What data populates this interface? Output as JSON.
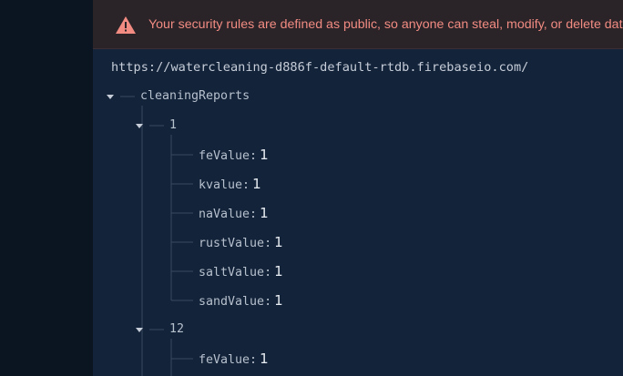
{
  "warning": {
    "icon": "warning-triangle-icon",
    "text": "Your security rules are defined as public, so anyone can steal, modify, or delete data in your database",
    "color": "#f28b82"
  },
  "database": {
    "url": "https://watercleaning-d886f-default-rtdb.firebaseio.com/"
  },
  "tree": {
    "root_key": "cleaningReports",
    "children": [
      {
        "key": "1",
        "fields": [
          {
            "key": "feValue",
            "value": "1"
          },
          {
            "key": "kvalue",
            "value": "1"
          },
          {
            "key": "naValue",
            "value": "1"
          },
          {
            "key": "rustValue",
            "value": "1"
          },
          {
            "key": "saltValue",
            "value": "1"
          },
          {
            "key": "sandValue",
            "value": "1"
          }
        ]
      },
      {
        "key": "12",
        "fields": [
          {
            "key": "feValue",
            "value": "1"
          }
        ]
      }
    ]
  }
}
